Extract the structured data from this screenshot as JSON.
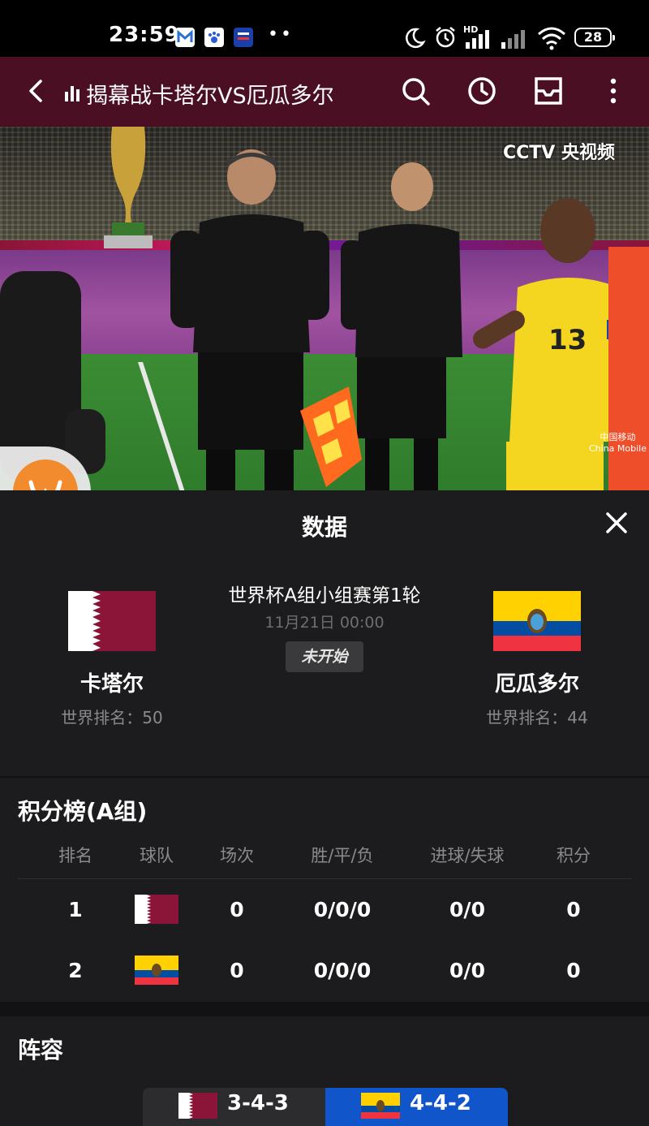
{
  "status_bar": {
    "time": "23:59",
    "battery": "28",
    "hd_label": "HD",
    "dots": "••"
  },
  "header": {
    "title": "揭幕战卡塔尔VS厄瓜多尔"
  },
  "video": {
    "broadcaster": "CCTV 央视频",
    "sponsor": "中国移动\nChina Mobile"
  },
  "panel": {
    "title": "数据",
    "match_title": "世界杯A组小组赛第1轮",
    "match_time": "11月21日 00:00",
    "match_status": "未开始",
    "home": {
      "name": "卡塔尔",
      "rank": "世界排名：50"
    },
    "away": {
      "name": "厄瓜多尔",
      "rank": "世界排名：44"
    }
  },
  "standings": {
    "title": "积分榜(A组)",
    "headers": [
      "排名",
      "球队",
      "场次",
      "胜/平/负",
      "进球/失球",
      "积分"
    ],
    "rows": [
      {
        "rank": "1",
        "team_flag": "qatar",
        "played": "0",
        "wdl": "0/0/0",
        "goals": "0/0",
        "points": "0"
      },
      {
        "rank": "2",
        "team_flag": "ecuador",
        "played": "0",
        "wdl": "0/0/0",
        "goals": "0/0",
        "points": "0"
      }
    ]
  },
  "lineup": {
    "title": "阵容",
    "tabs": [
      {
        "flag": "qatar",
        "formation": "3-4-3",
        "active": false
      },
      {
        "flag": "ecuador",
        "formation": "4-4-2",
        "active": true
      }
    ]
  },
  "colors": {
    "header_bg": "#4a0f23",
    "qatar_maroon": "#8a1538",
    "ecuador_yellow": "#ffd100",
    "ecuador_blue": "#034ea2",
    "ecuador_red": "#ef3340",
    "active_tab": "#1055c9",
    "float_orange": "#f28a2e"
  }
}
